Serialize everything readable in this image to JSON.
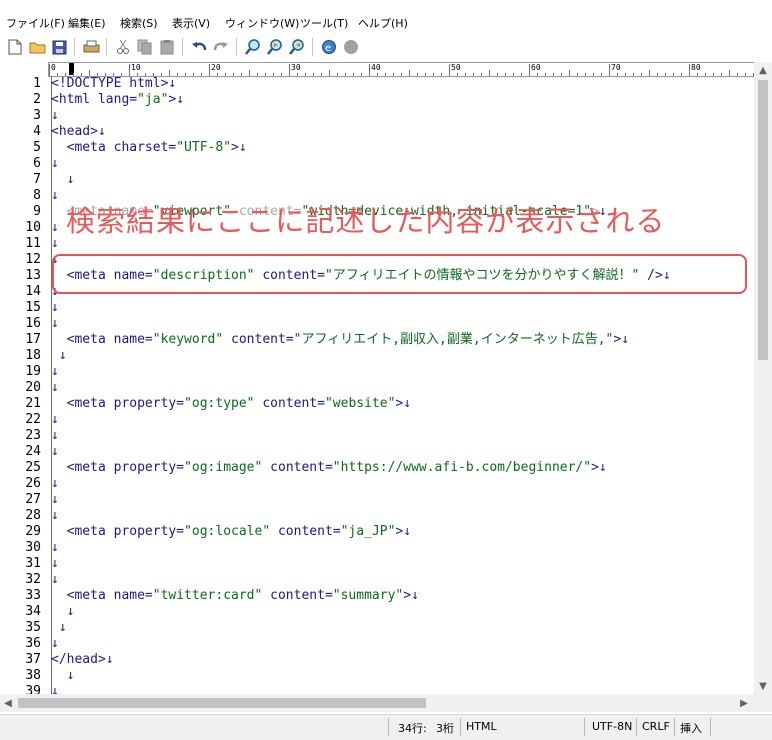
{
  "menu": [
    "ファイル(F)",
    "編集(E)",
    "検索(S)",
    "表示(V)",
    "ウィンドウ(W)",
    "ツール(T)",
    "ヘルプ(H)"
  ],
  "toolbar_icons": [
    "new-file-icon",
    "open-folder-icon",
    "save-icon",
    "print-icon",
    "cut-icon",
    "copy-icon",
    "paste-icon",
    "undo-icon",
    "redo-icon",
    "search-icon",
    "search-next-icon",
    "search-prev-icon",
    "browser-icon",
    "record-icon"
  ],
  "ruler_labels": [
    "0",
    "10",
    "20",
    "30",
    "40",
    "50",
    "60",
    "70",
    "80"
  ],
  "annotation": "検索結果にここに記述した内容が表示される",
  "lines": [
    {
      "n": "1",
      "text": "<!DOCTYPE html>"
    },
    {
      "n": "2",
      "text": "<html lang=\"ja\">"
    },
    {
      "n": "3",
      "text": ""
    },
    {
      "n": "4",
      "text": "<head>"
    },
    {
      "n": "5",
      "text": "  <meta charset=\"UTF-8\">"
    },
    {
      "n": "6",
      "text": ""
    },
    {
      "n": "7",
      "text": "  "
    },
    {
      "n": "8",
      "text": ""
    },
    {
      "n": "9",
      "text": "  <meta name=\"viewport\" content=\"width=device-width, initial-scale=1\">"
    },
    {
      "n": "10",
      "text": ""
    },
    {
      "n": "11",
      "text": ""
    },
    {
      "n": "12",
      "text": ""
    },
    {
      "n": "13",
      "text": "  <meta name=\"description\" content=\"アフィリエイトの情報やコツを分かりやすく解説！\" />"
    },
    {
      "n": "14",
      "text": ""
    },
    {
      "n": "15",
      "text": ""
    },
    {
      "n": "16",
      "text": ""
    },
    {
      "n": "17",
      "text": "  <meta name=\"keyword\" content=\"アフィリエイト,副収入,副業,インターネット広告,\">"
    },
    {
      "n": "18",
      "text": " "
    },
    {
      "n": "19",
      "text": ""
    },
    {
      "n": "20",
      "text": ""
    },
    {
      "n": "21",
      "text": "  <meta property=\"og:type\" content=\"website\">"
    },
    {
      "n": "22",
      "text": ""
    },
    {
      "n": "23",
      "text": ""
    },
    {
      "n": "24",
      "text": ""
    },
    {
      "n": "25",
      "text": "  <meta property=\"og:image\" content=\"https://www.afi-b.com/beginner/\">"
    },
    {
      "n": "26",
      "text": ""
    },
    {
      "n": "27",
      "text": ""
    },
    {
      "n": "28",
      "text": ""
    },
    {
      "n": "29",
      "text": "  <meta property=\"og:locale\" content=\"ja_JP\">"
    },
    {
      "n": "30",
      "text": ""
    },
    {
      "n": "31",
      "text": ""
    },
    {
      "n": "32",
      "text": ""
    },
    {
      "n": "33",
      "text": "  <meta name=\"twitter:card\" content=\"summary\">"
    },
    {
      "n": "34",
      "text": "  "
    },
    {
      "n": "35",
      "text": " "
    },
    {
      "n": "36",
      "text": ""
    },
    {
      "n": "37",
      "text": "</head>"
    },
    {
      "n": "38",
      "text": "  "
    },
    {
      "n": "39",
      "text": ""
    }
  ],
  "status": {
    "row": "34行:",
    "col": "3桁",
    "mode": "HTML",
    "encoding": "UTF-8N",
    "eol": "CRLF",
    "insert": "挿入"
  },
  "colors": {
    "annotation": "#e85a5a",
    "string": "#0b6a1d",
    "code": "#1a1a8a"
  }
}
